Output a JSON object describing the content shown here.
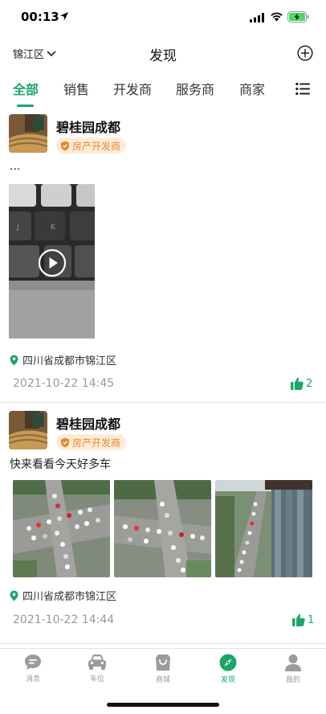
{
  "status_bar": {
    "time": "00:13"
  },
  "nav": {
    "district": "锦江区",
    "title": "发现"
  },
  "tabs": [
    {
      "label": "全部",
      "active": true
    },
    {
      "label": "销售",
      "active": false
    },
    {
      "label": "开发商",
      "active": false
    },
    {
      "label": "服务商",
      "active": false
    },
    {
      "label": "商家",
      "active": false
    }
  ],
  "posts": [
    {
      "name": "碧桂园成都",
      "badge": "房产开发商",
      "text": "...",
      "media": "video",
      "location": "四川省成都市锦江区",
      "time": "2021-10-22 14:45",
      "likes": "2"
    },
    {
      "name": "碧桂园成都",
      "badge": "房产开发商",
      "text": "快来看看今天好多车",
      "media": "photos",
      "location": "四川省成都市锦江区",
      "time": "2021-10-22 14:44",
      "likes": "1"
    }
  ],
  "tabbar": [
    {
      "label": "消息",
      "icon": "message-icon",
      "active": false
    },
    {
      "label": "车位",
      "icon": "car-icon",
      "active": false
    },
    {
      "label": "商城",
      "icon": "shop-bag-icon",
      "active": false
    },
    {
      "label": "发现",
      "icon": "compass-icon",
      "active": true
    },
    {
      "label": "我的",
      "icon": "user-icon",
      "active": false
    }
  ],
  "colors": {
    "accent": "#1aa667",
    "badge_bg": "#fdecd8",
    "badge_text": "#e8872a"
  }
}
